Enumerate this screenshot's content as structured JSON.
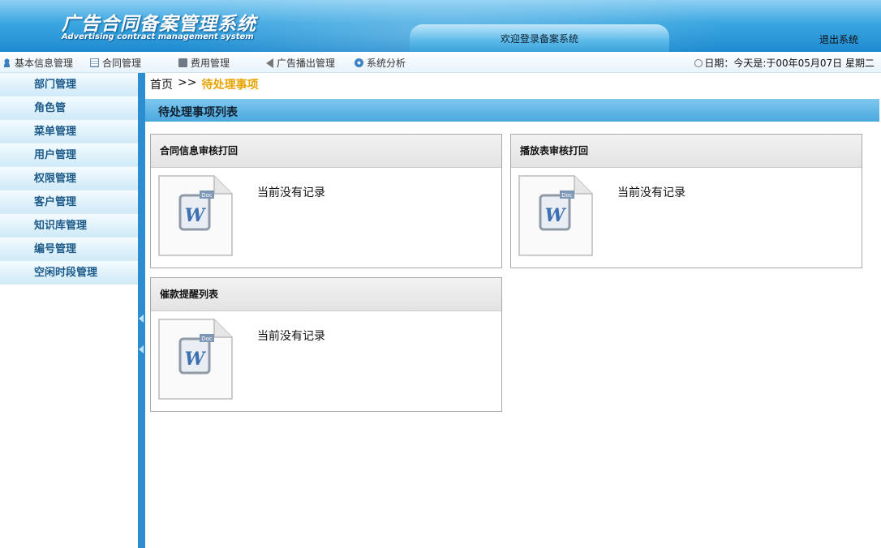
{
  "header": {
    "logo_cn": "广告合同备案管理系统",
    "logo_en": "Advertising contract management system",
    "welcome": "欢迎登录备案系统",
    "logout": "退出系统"
  },
  "topnav": {
    "items": [
      {
        "label": "基本信息管理",
        "icon": "user-icon"
      },
      {
        "label": "合同管理",
        "icon": "document-icon"
      },
      {
        "label": "费用管理",
        "icon": "calculator-icon"
      },
      {
        "label": "广告播出管理",
        "icon": "speaker-icon"
      },
      {
        "label": "系统分析",
        "icon": "gear-icon"
      }
    ],
    "date_text": "日期：今天是:于00年05月07日  星期二"
  },
  "sidebar": {
    "items": [
      {
        "label": "部门管理"
      },
      {
        "label": "角色管"
      },
      {
        "label": "菜单管理"
      },
      {
        "label": "用户管理"
      },
      {
        "label": "权限管理"
      },
      {
        "label": "客户管理"
      },
      {
        "label": "知识库管理"
      },
      {
        "label": "编号管理"
      },
      {
        "label": "空闲时段管理"
      }
    ]
  },
  "main": {
    "breadcrumb": {
      "home": "首页",
      "sep": ">>",
      "current": "待处理事项"
    },
    "section_title": "待处理事项列表",
    "panels": [
      {
        "title": "合同信息审核打回",
        "message": "当前没有记录"
      },
      {
        "title": "播放表审核打回",
        "message": "当前没有记录"
      },
      {
        "title": "催款提醒列表",
        "message": "当前没有记录"
      }
    ]
  },
  "colors": {
    "header_blue": "#3aa6e0",
    "splitter_blue": "#2c8ed0",
    "breadcrumb_accent": "#e8a300",
    "sidebar_text": "#1c5a8a"
  }
}
